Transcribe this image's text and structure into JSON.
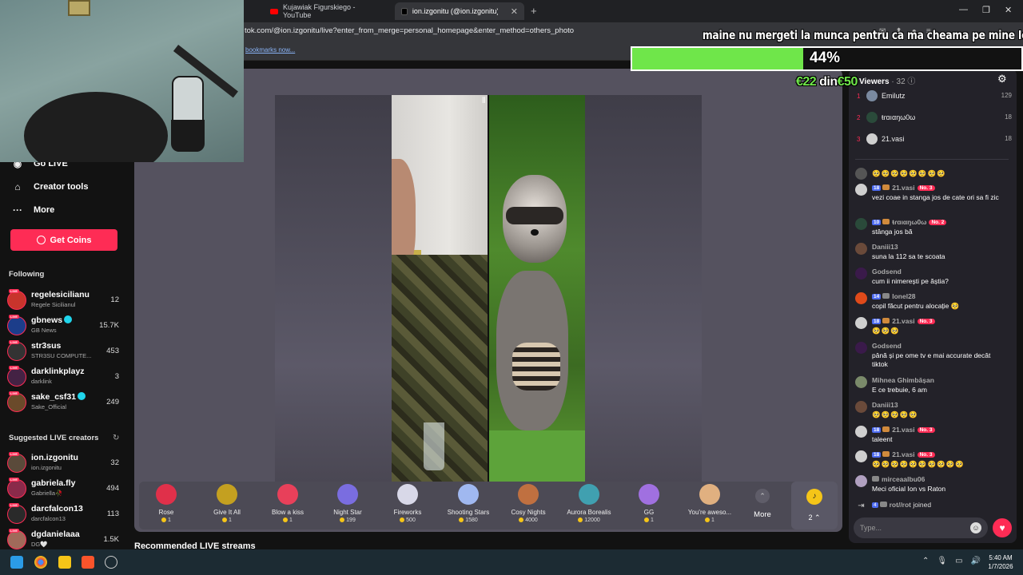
{
  "browser": {
    "tabs": [
      {
        "title": "Kujawiak Figurskiego - YouTube",
        "active": false
      },
      {
        "title": "ion.izgonitu (@ion.izgonitu) is LI",
        "active": true
      }
    ],
    "url": "tok.com/@ion.izgonitu/live?enter_from_merge=personal_homepage&enter_method=others_photo",
    "bookmarks_link": "bookmarks now..."
  },
  "sidebar": {
    "nav": [
      {
        "label": "Go LIVE",
        "icon": "live-icon"
      },
      {
        "label": "Creator tools",
        "icon": "creator-tools-icon"
      },
      {
        "label": "More",
        "icon": "more-dots-icon"
      }
    ],
    "get_coins": "Get Coins",
    "following_title": "Following",
    "following": [
      {
        "name": "regelesicilianu",
        "sub": "Regele Sicilianul",
        "count": "12",
        "verified": false
      },
      {
        "name": "gbnews",
        "sub": "GB News",
        "count": "15.7K",
        "verified": true
      },
      {
        "name": "str3sus",
        "sub": "STR3SU COMPUTE...",
        "count": "453",
        "verified": false
      },
      {
        "name": "darklinkplayz",
        "sub": "darklink",
        "count": "3",
        "verified": false
      },
      {
        "name": "sake_csf31",
        "sub": "Sake_Official",
        "count": "249",
        "verified": true
      }
    ],
    "suggested_title": "Suggested LIVE creators",
    "suggested": [
      {
        "name": "ion.izgonitu",
        "sub": "ion.izgonitu",
        "count": "32"
      },
      {
        "name": "gabriela.fly",
        "sub": "Gabriella🥀",
        "count": "494"
      },
      {
        "name": "darcfalcon13",
        "sub": "darcfalcon13",
        "count": "113"
      },
      {
        "name": "dgdanielaaa",
        "sub": "DG🤍",
        "count": "1.5K"
      }
    ]
  },
  "goal": {
    "title": "maine nu mergeti la munca pentru ca ma cheama pe mine Ion",
    "percent_label": "44%",
    "progress": 0.44,
    "current": "€22",
    "din": "din",
    "target": "€50"
  },
  "gifts": [
    {
      "name": "Rose",
      "price": "1",
      "color": "#e0304a"
    },
    {
      "name": "Give It All",
      "price": "1",
      "color": "#c4a020"
    },
    {
      "name": "Blow a kiss",
      "price": "1",
      "color": "#e8405a"
    },
    {
      "name": "Night Star",
      "price": "199",
      "color": "#7a6de0"
    },
    {
      "name": "Fireworks",
      "price": "500",
      "color": "#d8d8e8"
    },
    {
      "name": "Shooting Stars",
      "price": "1580",
      "color": "#a0b8f0"
    },
    {
      "name": "Cosy Nights",
      "price": "4000",
      "color": "#c07040"
    },
    {
      "name": "Aurora Borealis",
      "price": "12000",
      "color": "#40a0b0"
    },
    {
      "name": "GG",
      "price": "1",
      "color": "#a070e0"
    },
    {
      "name": "You're aweso...",
      "price": "1",
      "color": "#e0b080"
    }
  ],
  "more_label": "More",
  "tokens_label": "2 ⌃",
  "recommended": "Recommended LIVE streams",
  "viewers": {
    "title": "Viewers",
    "count": "· 32",
    "top": [
      {
        "rank": "1",
        "name": "Emilutz",
        "score": "129"
      },
      {
        "rank": "2",
        "name": "ŧɾɑıαŋω0ω",
        "score": "18"
      },
      {
        "rank": "3",
        "name": "21.vasi",
        "score": "18"
      }
    ]
  },
  "chat": [
    {
      "name": "",
      "text": "🥺🥺🥺🥺🥺🥺🥺🥺",
      "level": "",
      "no": ""
    },
    {
      "name": "21.vasi",
      "text": "vezi coae in stanga jos de cate ori sa fi zic",
      "level": "18",
      "no": "No. 3"
    },
    {
      "name": "ŧɾɑıαŋω0ω",
      "text": "stânga jos bă",
      "level": "10",
      "no": "No. 2"
    },
    {
      "name": "Daniii13",
      "text": "suna la 112 sa te scoata",
      "level": "",
      "no": ""
    },
    {
      "name": "Godsend",
      "text": "cum ii nimerești pe ăștia?",
      "level": "",
      "no": ""
    },
    {
      "name": "Ionel28",
      "text": "copil făcut pentru alocație 🥺",
      "level": "14",
      "no": ""
    },
    {
      "name": "21.vasi",
      "text": "🥺🥺🥺",
      "level": "18",
      "no": "No. 3"
    },
    {
      "name": "Godsend",
      "text": "până și pe ome tv e mai accurate decât tiktok",
      "level": "",
      "no": ""
    },
    {
      "name": "Mihnea Ghimbășan",
      "text": "E ce trebuie, 6 am",
      "level": "",
      "no": ""
    },
    {
      "name": "Daniii13",
      "text": "🥺🥺🥺🥺🥺",
      "level": "",
      "no": ""
    },
    {
      "name": "21.vasi",
      "text": "taleent",
      "level": "18",
      "no": "No. 3"
    },
    {
      "name": "21.vasi",
      "text": "🥺🥺🥺🥺🥺🥺🥺🥺🥺🥺",
      "level": "18",
      "no": "No. 3"
    },
    {
      "name": "mirceaalbu06",
      "text": "Meci oficial Ion vs Raton",
      "level": "",
      "no": ""
    }
  ],
  "join": {
    "level": "4",
    "name": "rot//rot",
    "action": "joined"
  },
  "chat_input_placeholder": "Type...",
  "taskbar": {
    "time": "5:40 AM",
    "date": "1/7/2026"
  }
}
